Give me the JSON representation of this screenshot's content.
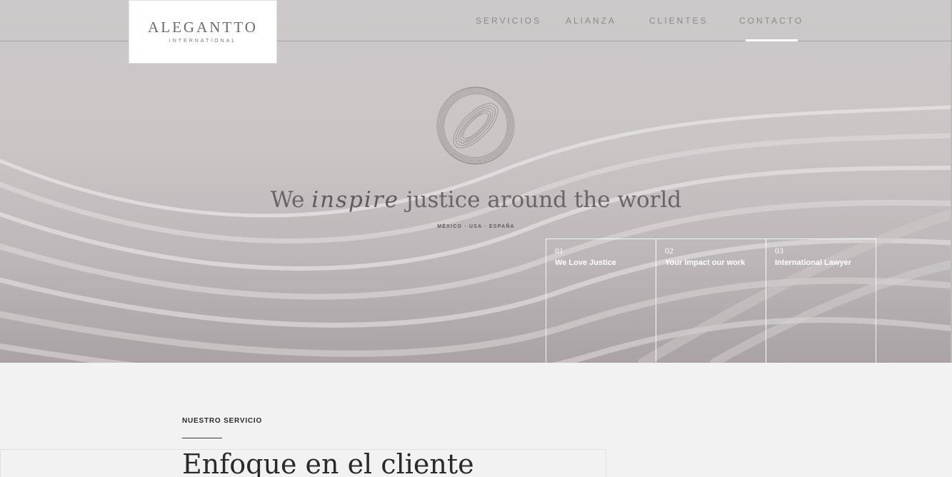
{
  "brand": {
    "name": "ALEGANTTO",
    "subtitle": "INTERNATIONAL"
  },
  "nav": {
    "items": [
      {
        "label": "SERVICIOS"
      },
      {
        "label": "ALIANZA"
      },
      {
        "label": "CLIENTES"
      },
      {
        "label": "CONTACTO",
        "active": true
      }
    ]
  },
  "hero": {
    "tagline_start": "We",
    "tagline_script": "inspire",
    "tagline_end": "justice around the world",
    "locations": "MÉXICO · USA · ESPAÑA",
    "cards": [
      {
        "number": "01",
        "title": "We Love Justice"
      },
      {
        "number": "02",
        "title": "Your Impact our work"
      },
      {
        "number": "03",
        "title": "International Lawyer"
      }
    ]
  },
  "services": {
    "label": "NUESTRO SERVICIO",
    "title": "Enfoque en el cliente"
  },
  "colors": {
    "hero_bg": "#cdc8c9",
    "nav_text": "#8d888a",
    "active_underline": "#ffffff",
    "page_bg": "#f3f2f2",
    "heading_text": "#2b292a"
  }
}
